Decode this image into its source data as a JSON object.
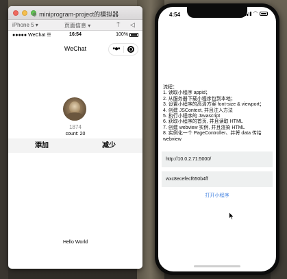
{
  "simulator": {
    "window_title": "miniprogram-project的模拟器",
    "toolbar": {
      "device": "iPhone 5 ▾",
      "page_info": "页面信息 ▾",
      "pin_glyph": "⍑",
      "back_glyph": "◁"
    },
    "status_bar": {
      "carrier": "●●●●● WeChat ☲",
      "time": "16:54",
      "battery": "100%"
    },
    "nav": {
      "title": "WeChat",
      "more_glyph": "•●•"
    },
    "content": {
      "number": "1874",
      "count_text": "count: 20",
      "add_label": "添加",
      "reduce_label": "减少",
      "hello": "Hello World"
    }
  },
  "phone": {
    "time": "4:54",
    "wifi_glyph": "◠",
    "steps": [
      "流程：",
      "1. 读取小程序 appid；",
      "2. 从服务器下载小程序包到本地；",
      "3. 设置小程序的高清方案 font-size & viewport；",
      "4. 创建 JSContext, 并且注入方法",
      "5. 执行小程序的 Javascript",
      "6. 获取小程序的首页, 并且读取 HTML",
      "7. 创建 webview 实例, 并且渲染 HTML",
      "8. 实例化一个 PageController、并将 data 传给 webview"
    ],
    "url_value": "http://10.0.2.71:5000/",
    "appid_value": "wxc8ecefecf650b4ff",
    "open_label": "打开小程序"
  }
}
